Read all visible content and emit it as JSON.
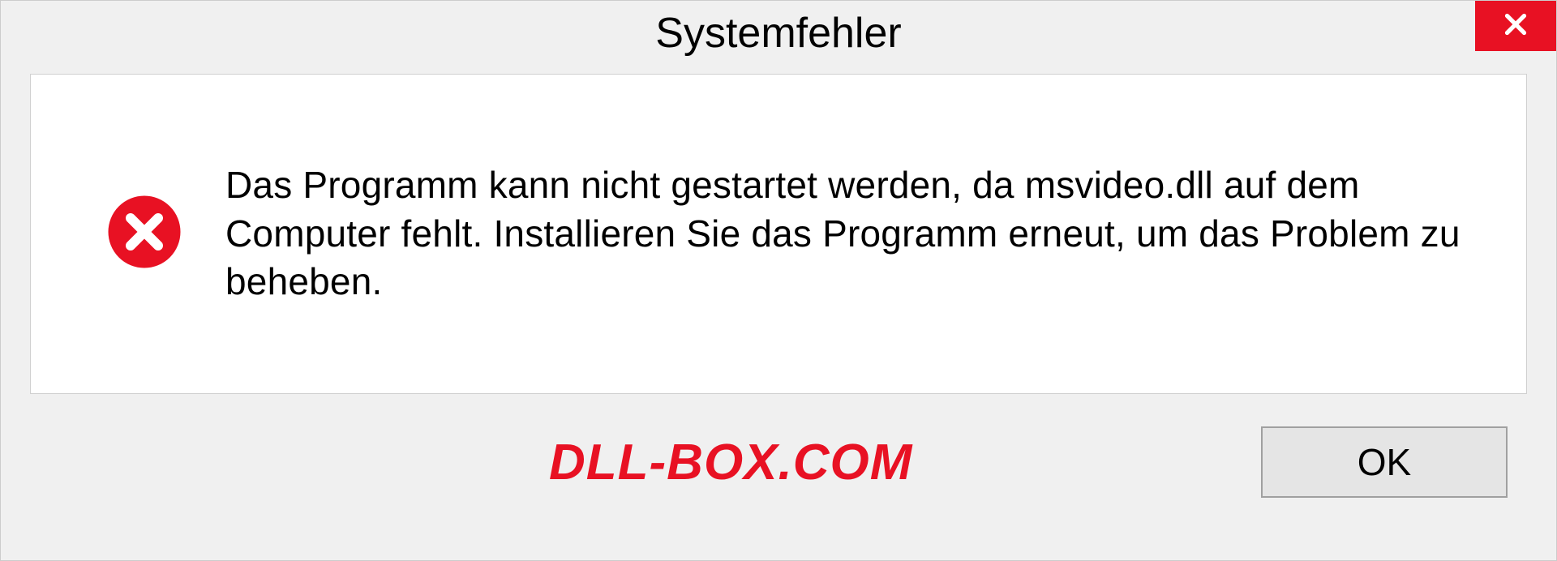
{
  "dialog": {
    "title": "Systemfehler",
    "message": "Das Programm kann nicht gestartet werden, da msvideo.dll auf dem Computer fehlt. Installieren Sie das Programm erneut, um das Problem zu beheben.",
    "ok_label": "OK",
    "watermark": "DLL-BOX.COM"
  }
}
